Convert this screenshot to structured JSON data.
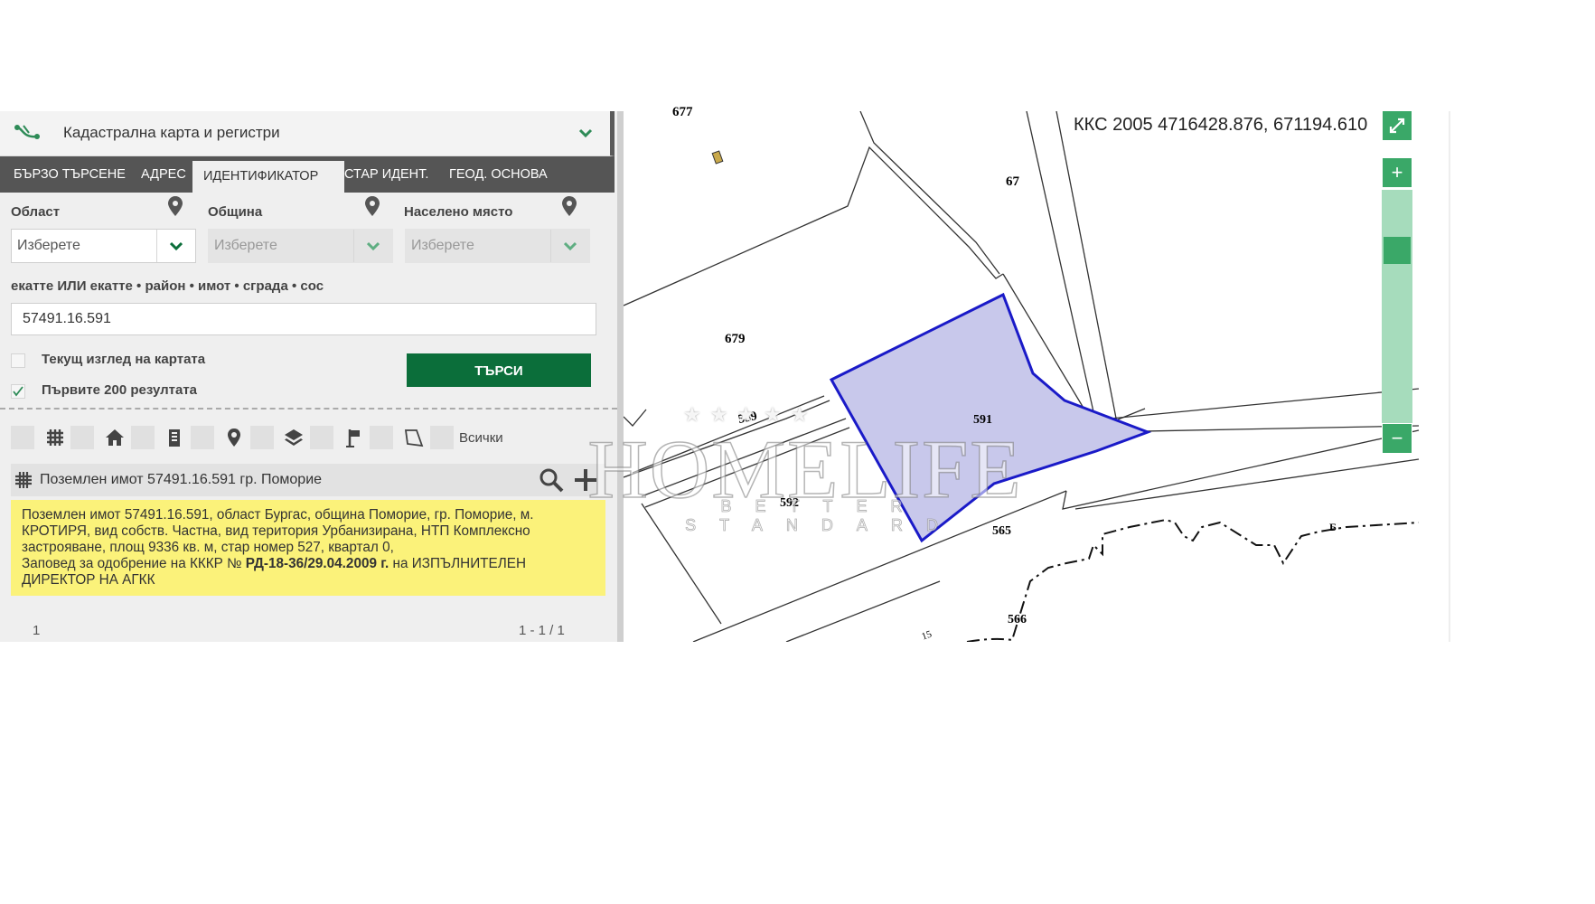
{
  "panel": {
    "header_title": "Кадастрална карта и регистри",
    "tabs": [
      {
        "label": "БЪРЗО ТЪРСЕНЕ"
      },
      {
        "label": "АДРЕС"
      },
      {
        "label": "ИДЕНТИФИКАТОР"
      },
      {
        "label": "СТАР ИДЕНТ."
      },
      {
        "label": "ГЕОД. ОСНОВА"
      }
    ],
    "fields": {
      "oblast_label": "Област",
      "obshtina_label": "Община",
      "naseleno_label": "Населено място",
      "oblast_placeholder": "Изберете",
      "obshtina_placeholder": "Изберете",
      "naseleno_placeholder": "Изберете"
    },
    "identifier_label": "екатте ИЛИ екатте • район • имот • сграда • сос",
    "identifier_value": "57491.16.591",
    "checkbox_current_view": "Текущ изглед на картата",
    "checkbox_first_200": "Първите 200 резултата",
    "search_button": "ТЪРСИ",
    "filter_all": "Всички",
    "result_title": "Поземлен имот 57491.16.591 гр. Поморие",
    "info": {
      "line1": "Поземлен имот 57491.16.591, област Бургас, община Поморие, гр. Поморие, м.",
      "line2": "КРОТИРЯ, вид собств. Частна, вид територия Урбанизирана, НТП Комплексно",
      "line3": "застрояване, площ 9336 кв. м, стар номер 527, квартал 0,",
      "line4_pre": "Заповед за одобрение на КККР № ",
      "line4_bold": "РД-18-36/29.04.2009 г.",
      "line4_post": " на ИЗПЪЛНИТЕЛЕН",
      "line5": "ДИРЕКТОР НА АГКК"
    },
    "pager_left": "1",
    "pager_right": "1 - 1 / 1"
  },
  "map": {
    "coords": "ККС 2005 4716428.876, 671194.610",
    "zoom_in": "+",
    "zoom_out": "−",
    "labels": {
      "p677": "677",
      "p67": "67",
      "p679": "679",
      "p559": "559",
      "p591": "591",
      "p592": "592",
      "p565": "565",
      "p566": "566",
      "pB": "Б",
      "p15": "15"
    },
    "parcel_fill": "#c8c8eb",
    "parcel_stroke": "#1a1ac8"
  },
  "watermark": {
    "brand": "HOMELIFE",
    "tagline": "BETTER STANDARD"
  },
  "colors": {
    "accent_green": "#0b6e3a",
    "control_green": "#3aa868",
    "info_yellow": "#fbf27a"
  }
}
